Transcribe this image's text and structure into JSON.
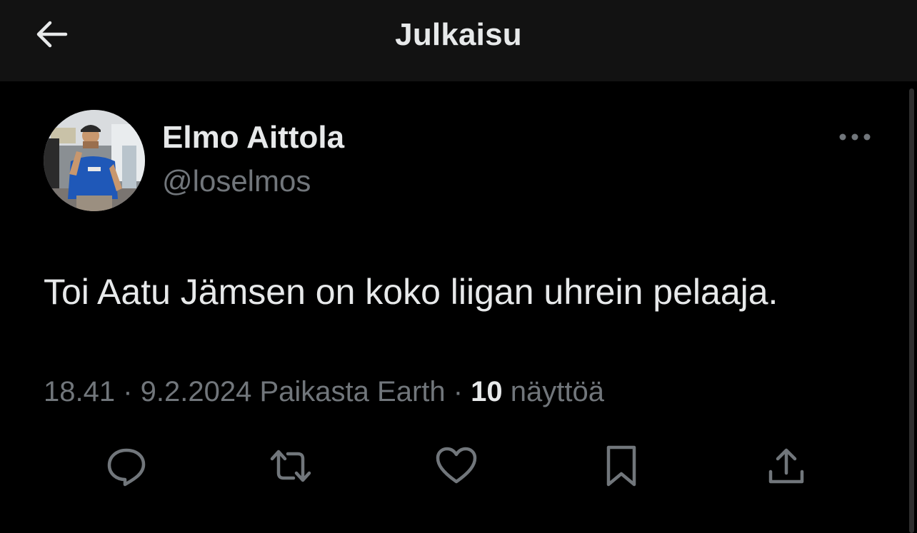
{
  "header": {
    "title": "Julkaisu",
    "back_icon": "arrow-left-icon"
  },
  "author": {
    "display_name": "Elmo Aittola",
    "handle": "@loselmos",
    "more_icon": "more-horizontal-icon"
  },
  "tweet": {
    "text": "Toi Aatu Jämsen on koko liigan uhrein pelaaja.",
    "time": "18.41",
    "separator": " · ",
    "date": "9.2.2024",
    "source": "Paikasta Earth",
    "views_count": "10",
    "views_label": "näyttöä"
  },
  "actions": [
    {
      "icon": "reply-icon"
    },
    {
      "icon": "retweet-icon"
    },
    {
      "icon": "like-icon"
    },
    {
      "icon": "bookmark-icon"
    },
    {
      "icon": "share-icon"
    }
  ],
  "colors": {
    "background": "#000000",
    "header_bg": "#121212",
    "primary_text": "#e7e9ea",
    "secondary_text": "#71767b"
  }
}
